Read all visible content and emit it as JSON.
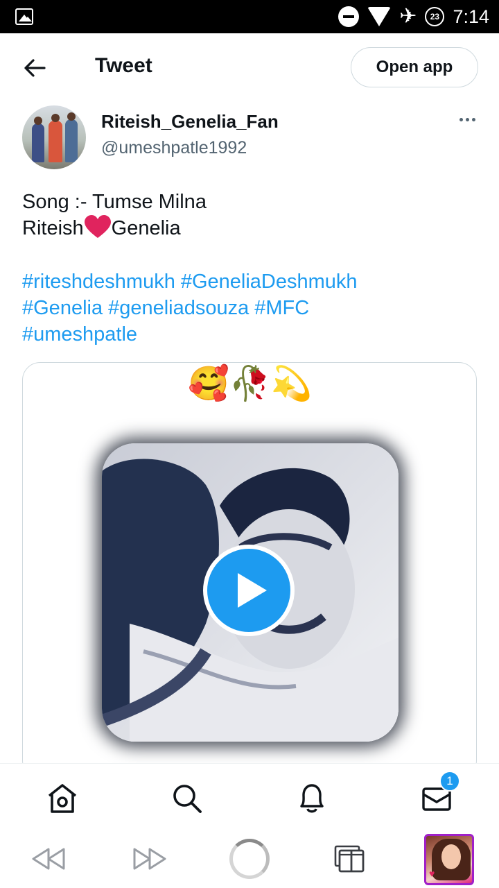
{
  "status_bar": {
    "time": "7:14",
    "data_indicator": "23",
    "icons": [
      "gallery-icon",
      "do-not-disturb-icon",
      "wifi-icon",
      "airplane-mode-icon",
      "data-saver-icon"
    ]
  },
  "header": {
    "title": "Tweet",
    "open_app_label": "Open app"
  },
  "tweet": {
    "author": {
      "display_name": "Riteish_Genelia_Fan",
      "handle": "@umeshpatle1992"
    },
    "text_line1": "Song :- Tumse Milna",
    "text_line2_a": "Riteish",
    "text_line2_b": "Genelia",
    "hashtags": [
      "#riteshdeshmukh",
      "#GeneliaDeshmukh",
      "#Genelia",
      "#geneliadsouza",
      "#MFC",
      "#umeshpatle"
    ],
    "media": {
      "emoji_overlay": "🥰🥀💫",
      "play_icon": "play-icon"
    }
  },
  "tab_bar": {
    "items": [
      "home-icon",
      "search-icon",
      "notifications-icon",
      "messages-icon"
    ],
    "messages_badge": "1"
  },
  "colors": {
    "accent": "#1d9bf0",
    "text": "#0f1419",
    "secondary": "#536471",
    "heart": "#e0245e"
  }
}
